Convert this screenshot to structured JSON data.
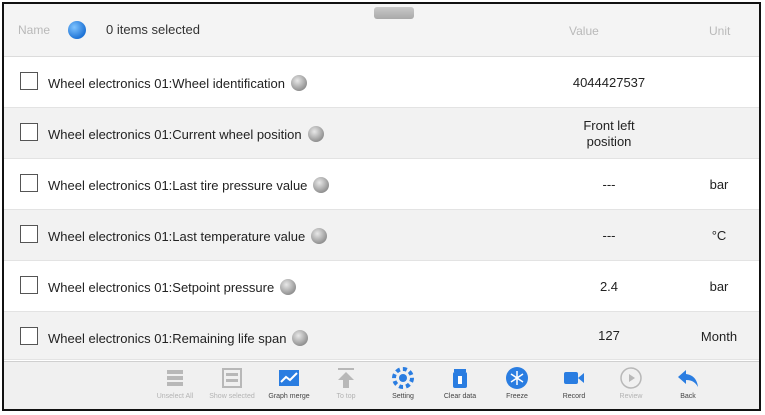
{
  "header": {
    "name_label": "Name",
    "selected_text": "0 items selected",
    "value_label": "Value",
    "unit_label": "Unit"
  },
  "rows": [
    {
      "name": "Wheel electronics 01:Wheel identification",
      "value": "4044427537",
      "unit": ""
    },
    {
      "name": "Wheel electronics 01:Current wheel position",
      "value": "Front left position",
      "unit": ""
    },
    {
      "name": "Wheel electronics 01:Last tire pressure value",
      "value": "---",
      "unit": "bar"
    },
    {
      "name": "Wheel electronics 01:Last temperature value",
      "value": "---",
      "unit": "°C"
    },
    {
      "name": "Wheel electronics 01:Setpoint pressure",
      "value": "2.4",
      "unit": "bar"
    },
    {
      "name": "Wheel electronics 01:Remaining life span",
      "value": "127",
      "unit": "Month"
    }
  ],
  "toolbar": [
    {
      "label": "Unselect All",
      "icon": "list-icon",
      "enabled": false
    },
    {
      "label": "Show selected",
      "icon": "list-selected-icon",
      "enabled": false
    },
    {
      "label": "Graph merge",
      "icon": "graph-icon",
      "enabled": true
    },
    {
      "label": "To top",
      "icon": "to-top-icon",
      "enabled": false
    },
    {
      "label": "Setting",
      "icon": "setting-icon",
      "enabled": true
    },
    {
      "label": "Clear data",
      "icon": "trash-icon",
      "enabled": true
    },
    {
      "label": "Freeze",
      "icon": "freeze-icon",
      "enabled": true
    },
    {
      "label": "Record",
      "icon": "record-icon",
      "enabled": true
    },
    {
      "label": "Review",
      "icon": "review-icon",
      "enabled": false
    },
    {
      "label": "Back",
      "icon": "back-icon",
      "enabled": true
    }
  ],
  "colors": {
    "accent": "#1f74d6",
    "header_bg": "#f4f4f4",
    "toolbar_bg": "#f0f0f0"
  }
}
